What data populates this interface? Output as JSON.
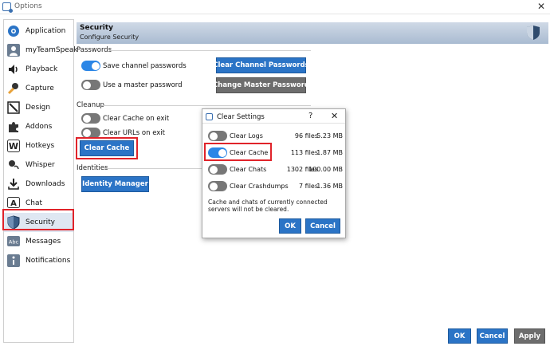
{
  "window": {
    "title": "Options",
    "close_glyph": "✕"
  },
  "sidebar": {
    "items": [
      {
        "label": "Application",
        "icon": "application-icon"
      },
      {
        "label": "myTeamSpeak",
        "icon": "user-icon"
      },
      {
        "label": "Playback",
        "icon": "speaker-icon"
      },
      {
        "label": "Capture",
        "icon": "microphone-icon"
      },
      {
        "label": "Design",
        "icon": "design-icon"
      },
      {
        "label": "Addons",
        "icon": "puzzle-icon"
      },
      {
        "label": "Hotkeys",
        "icon": "keyboard-icon"
      },
      {
        "label": "Whisper",
        "icon": "whisper-icon"
      },
      {
        "label": "Downloads",
        "icon": "download-icon"
      },
      {
        "label": "Chat",
        "icon": "chat-icon"
      },
      {
        "label": "Security",
        "icon": "shield-icon",
        "active": true
      },
      {
        "label": "Messages",
        "icon": "abc-icon"
      },
      {
        "label": "Notifications",
        "icon": "info-icon"
      }
    ]
  },
  "header": {
    "title": "Security",
    "subtitle": "Configure Security"
  },
  "passwords": {
    "label": "Passwords",
    "save_channel_passwords": {
      "label": "Save channel passwords",
      "on": true
    },
    "use_master_password": {
      "label": "Use a master password",
      "on": false
    },
    "clear_channel_passwords_button": "Clear Channel Passwords",
    "change_master_password_button": "Change Master Password"
  },
  "cleanup": {
    "label": "Cleanup",
    "clear_cache_on_exit": {
      "label": "Clear Cache on exit",
      "on": false
    },
    "clear_urls_on_exit": {
      "label": "Clear URLs on exit",
      "on": false
    },
    "clear_cache_button": "Clear Cache"
  },
  "identities": {
    "label": "Identities",
    "identity_manager_button": "Identity Manager"
  },
  "dialog": {
    "title": "Clear Settings",
    "help_glyph": "?",
    "close_glyph": "✕",
    "rows": [
      {
        "label": "Clear Logs",
        "files": "96 files",
        "size": "5.23 MB",
        "on": false
      },
      {
        "label": "Clear Cache",
        "files": "113 files",
        "size": "1.87 MB",
        "on": true
      },
      {
        "label": "Clear Chats",
        "files": "1302 files",
        "size": "100.00 MB",
        "on": false
      },
      {
        "label": "Clear Crashdumps",
        "files": "7 files",
        "size": "1.36 MB",
        "on": false
      }
    ],
    "note": "Cache and chats of currently connected servers will not be cleared.",
    "ok_button": "OK",
    "cancel_button": "Cancel"
  },
  "footer": {
    "ok_button": "OK",
    "cancel_button": "Cancel",
    "apply_button": "Apply"
  },
  "colors": {
    "accent": "#2b74c6",
    "toggle_on": "#2b86e6",
    "highlight": "#e0232a",
    "header": "#b9c8da"
  }
}
